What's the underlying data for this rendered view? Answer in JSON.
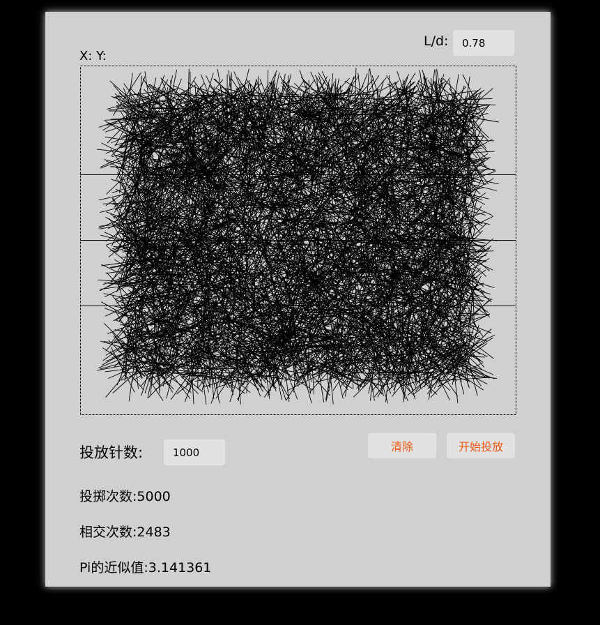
{
  "ld": {
    "label": "L/d:",
    "value": "0.78"
  },
  "coords": {
    "label": "X: Y:"
  },
  "controls": {
    "needle_count_label": "投放针数:",
    "needle_count_value": "1000",
    "clear_label": "清除",
    "start_label": "开始投放"
  },
  "stats": {
    "throws_label": "投掷次数:",
    "throws_value": "5000",
    "hits_label": "相交次数:",
    "hits_value": "2483",
    "pi_label": "Pi的近似值:",
    "pi_value": "3.141361"
  },
  "simulation": {
    "needles_drawn": 5000,
    "parallel_lines": 3,
    "needle_color": "#000000"
  },
  "colors": {
    "panel_bg": "#d0d0d0",
    "button_text": "#f05a14",
    "input_bg": "#e2e2e2"
  }
}
